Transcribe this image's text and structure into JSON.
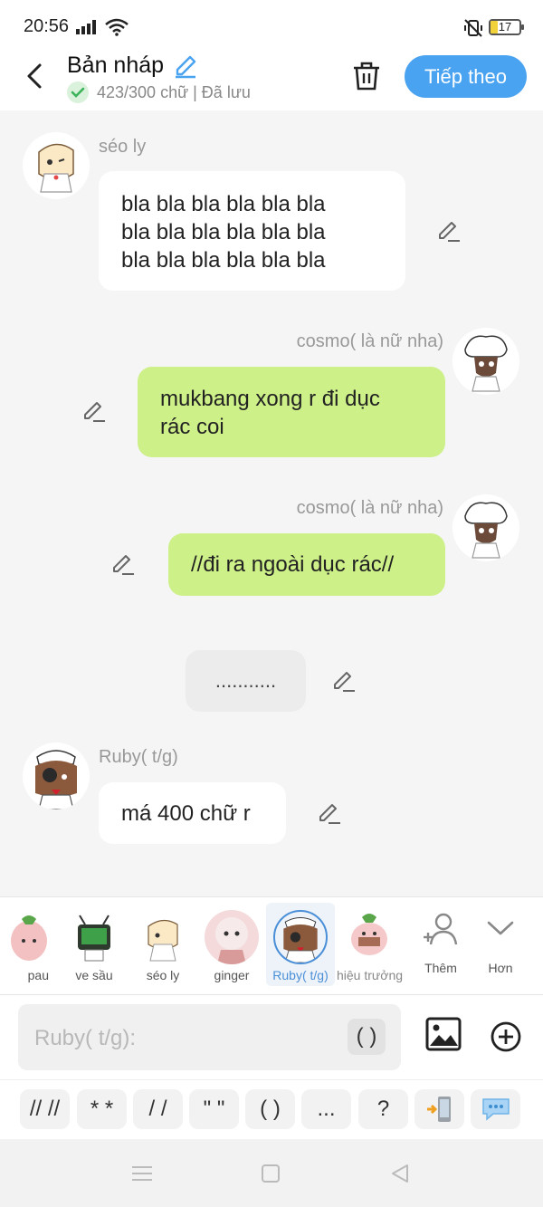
{
  "status_bar": {
    "time": "20:56",
    "battery": "17"
  },
  "header": {
    "title": "Bản nháp",
    "subtitle": "423/300 chữ | Đã lưu",
    "next_button": "Tiếp theo"
  },
  "messages": [
    {
      "speaker": "séo ly",
      "side": "left",
      "style": "white",
      "lines": [
        "bla bla bla bla bla bla",
        "bla bla bla bla bla bla",
        "bla bla bla bla bla bla"
      ]
    },
    {
      "speaker": "cosmo( là nữ nha)",
      "side": "right",
      "style": "green",
      "lines": [
        "mukbang xong r đi dục",
        "rác coi"
      ]
    },
    {
      "speaker": "cosmo( là nữ nha)",
      "side": "right",
      "style": "green",
      "lines": [
        "//đi ra ngoài dục rác//"
      ]
    },
    {
      "speaker": "",
      "side": "center",
      "style": "gray",
      "lines": [
        "..........."
      ]
    },
    {
      "speaker": "Ruby( t/g)",
      "side": "left",
      "style": "white",
      "lines": [
        "má 400 chữ r"
      ]
    }
  ],
  "characters": [
    {
      "label": "pau",
      "selected": false
    },
    {
      "label": "ve sầu",
      "selected": false
    },
    {
      "label": "séo ly",
      "selected": false
    },
    {
      "label": "ginger",
      "selected": false
    },
    {
      "label": "Ruby( t/g)",
      "selected": true
    },
    {
      "label": "hiệu trưởng",
      "selected": false
    }
  ],
  "strip_buttons": {
    "add": "Thêm",
    "more": "Hơn"
  },
  "input": {
    "placeholder": "Ruby( t/g):",
    "paren": "( )"
  },
  "shortcuts": [
    "// //",
    "* *",
    "/ /",
    "\" \"",
    "( )",
    "...",
    "?"
  ],
  "colors": {
    "accent": "#4aa3f0",
    "green_bubble": "#cdf088",
    "white_bubble": "#ffffff",
    "background": "#f5f5f5"
  }
}
